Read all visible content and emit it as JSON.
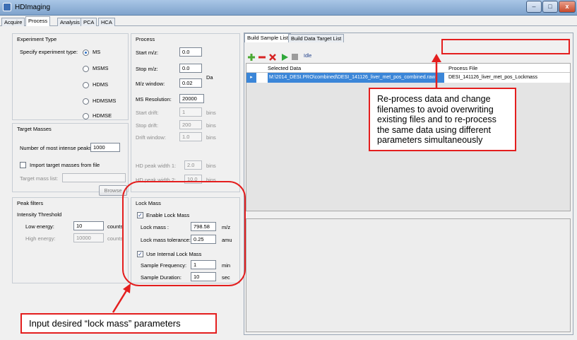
{
  "window": {
    "title": "HDImaging",
    "minimize": "–",
    "maximize": "□",
    "close": "x"
  },
  "main_tabs": [
    "Acquire",
    "Process",
    "Analysis",
    "PCA",
    "HCA"
  ],
  "experiment_type": {
    "title": "Experiment Type",
    "label": "Specify experiment type:",
    "options": [
      "MS",
      "MSMS",
      "HDMS",
      "HDMSMS",
      "HDMSE"
    ],
    "selected": "MS"
  },
  "process": {
    "title": "Process",
    "start_mz_label": "Start m/z:",
    "start_mz": "0.0",
    "stop_mz_label": "Stop m/z:",
    "stop_mz": "0.0",
    "mz_window_label": "M/z window:",
    "mz_window": "0.02",
    "da_unit": "Da",
    "ms_resolution_label": "MS Resolution:",
    "ms_resolution": "20000",
    "start_drift_label": "Start drift:",
    "start_drift": "1",
    "stop_drift_label": "Stop drift:",
    "stop_drift": "200",
    "drift_window_label": "Drift window:",
    "drift_window": "1.0",
    "bins_unit": "bins",
    "hd_peak_width1_label": "HD peak width 1:",
    "hd_peak_width1": "2.0",
    "hd_peak_width2_label": "HD peak width 2:",
    "hd_peak_width2": "10.0"
  },
  "target_masses": {
    "title": "Target Masses",
    "num_peaks_label": "Number of most intense peaks:",
    "num_peaks": "1000",
    "import_label": "Import target masses from file",
    "mass_list_label": "Target mass list:",
    "browse": "Browse"
  },
  "peak_filters": {
    "title": "Peak filters",
    "intensity_label": "Intensity Threshold",
    "low_energy_label": "Low energy:",
    "low_energy": "10",
    "high_energy_label": "High energy:",
    "high_energy": "10000",
    "counts_unit": "counts"
  },
  "lock_mass": {
    "title": "Lock Mass",
    "enable_label": "Enable Lock Mass",
    "lock_mass_label": "Lock mass :",
    "lock_mass": "798.58",
    "mz_unit": "m/z",
    "tolerance_label": "Lock mass tolerance:",
    "tolerance": "0.25",
    "amu_unit": "amu",
    "internal_label": "Use Internal Lock Mass",
    "freq_label": "Sample Frequency:",
    "freq": "1",
    "min_unit": "min",
    "duration_label": "Sample Duration:",
    "duration": "10",
    "sec_unit": "sec",
    "check_mark": "✓"
  },
  "right_tabs": [
    "Build Sample List",
    "Build Data Target List"
  ],
  "toolbar": {
    "status": "Idle"
  },
  "sample_table": {
    "headers": [
      "Selected Data",
      "Process File"
    ],
    "rows": [
      {
        "data": "M:\\2014_DESI.PRO\\combined\\DESI_141126_liver_met_pos_combined.raw",
        "process_file": "DESI_141126_liver_met_pos_Lockmass"
      }
    ]
  },
  "annotations": {
    "reprocess": "Re-process data and change filenames to avoid overwriting existing files and to re-process the same data using different parameters simultaneously",
    "lock_mass": "Input desired “lock mass” parameters"
  },
  "colors": {
    "annotation_red": "#e41e1e",
    "selection_blue": "#3b86d8"
  }
}
